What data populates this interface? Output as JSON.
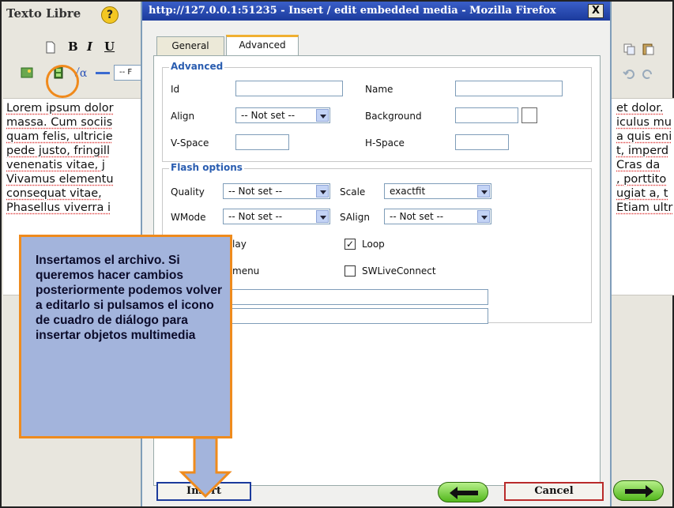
{
  "editor": {
    "title": "Texto Libre",
    "help_glyph": "?",
    "toolbar": {
      "bold": "B",
      "italic": "I",
      "underline": "U",
      "format_stub": "-- F"
    },
    "doc_lines": [
      "Lorem ipsum dolor",
      "massa. Cum sociis",
      "quam felis, ultricie",
      "pede justo, fringill",
      "venenatis vitae, j",
      "Vivamus elementu",
      "consequat vitae,",
      "Phasellus viverra i"
    ],
    "doc_lines_right": [
      "et dolor.",
      "iculus mu",
      "a quis eni",
      "t, imperd",
      "Cras da",
      ", porttito",
      "ugiat a, t",
      "Etiam ultr"
    ]
  },
  "dialog": {
    "title": "http://127.0.0.1:51235 - Insert / edit embedded media - Mozilla Firefox",
    "close_glyph": "X",
    "tabs": [
      {
        "label": "General",
        "active": false
      },
      {
        "label": "Advanced",
        "active": true
      }
    ],
    "advanced": {
      "legend": "Advanced",
      "id_label": "Id",
      "name_label": "Name",
      "align_label": "Align",
      "align_value": "-- Not set --",
      "background_label": "Background",
      "vspace_label": "V-Space",
      "hspace_label": "H-Space"
    },
    "flash": {
      "legend": "Flash options",
      "quality_label": "Quality",
      "quality_value": "-- Not set --",
      "scale_label": "Scale",
      "scale_value": "exactfit",
      "wmode_label": "WMode",
      "wmode_value": "-- Not set --",
      "salign_label": "SAlign",
      "salign_value": "-- Not set --",
      "autoplay_label": "lay",
      "loop_label": "Loop",
      "loop_checked": true,
      "menu_label": "menu",
      "swlive_label": "SWLiveConnect",
      "swlive_checked": false
    },
    "insert_label": "Insert",
    "cancel_label": "Cancel"
  },
  "callout": {
    "text": "Insertamos el archivo. Si queremos hacer cambios posteriormente podemos volver a editarlo si pulsamos el icono de cuadro de diálogo para insertar objetos multimedia",
    "border_color": "#ef8b1d",
    "fill_color": "#a3b4dc"
  }
}
